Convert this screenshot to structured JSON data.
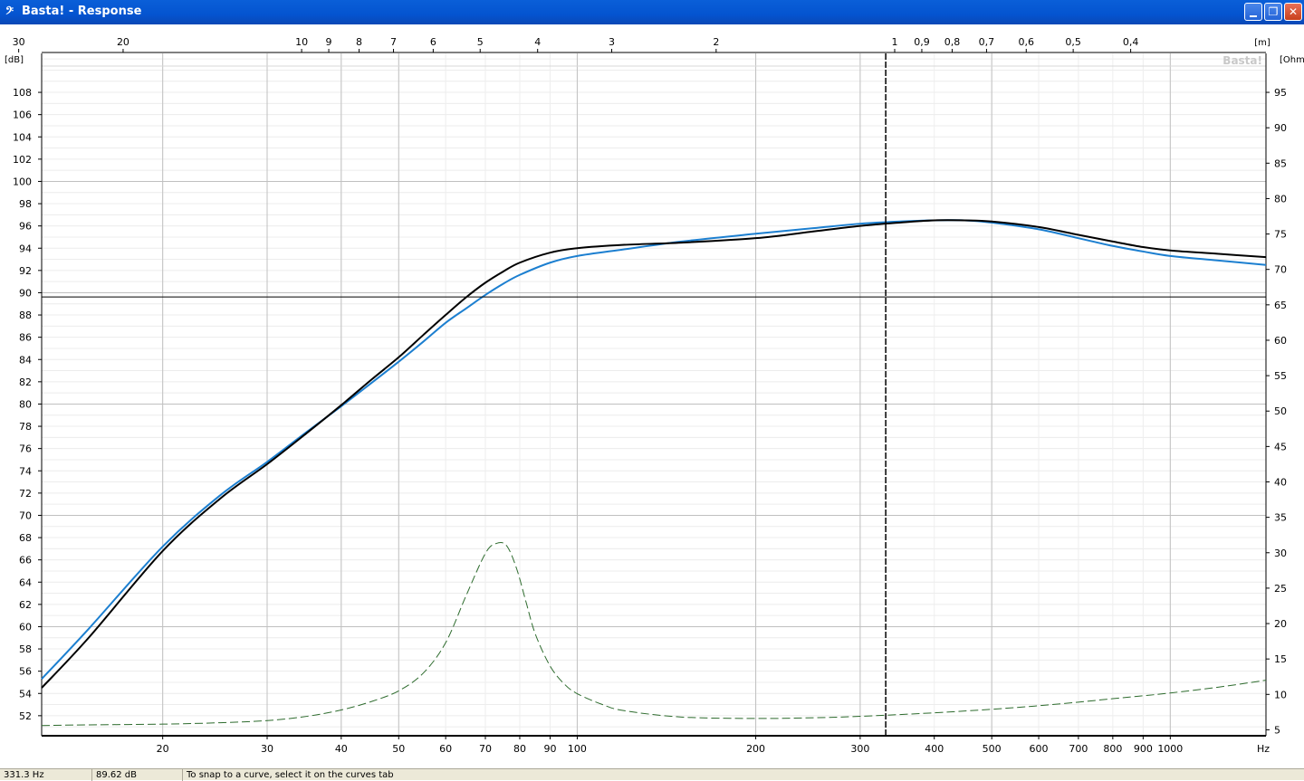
{
  "window": {
    "app_icon": "bass-clef-icon",
    "title": "Basta! - Response",
    "buttons": [
      "minimize",
      "restore",
      "close"
    ]
  },
  "statusbar": {
    "frequency": "331.3 Hz",
    "level": "89.62 dB",
    "hint": "To snap to a curve, select it on the curves tab"
  },
  "colors": {
    "response_blue": "#1c7fd0",
    "response_black": "#000000",
    "impedance_green": "#2d6b2d",
    "grid": "#c0c0c0"
  },
  "chart_data": {
    "type": "line",
    "watermark": "Basta!",
    "x_scale": "log",
    "xlim": [
      12.5,
      1450
    ],
    "x_ticks": [
      20,
      30,
      40,
      50,
      60,
      70,
      80,
      90,
      100,
      200,
      300,
      400,
      500,
      600,
      700,
      800,
      900,
      1000
    ],
    "x_unit": "Hz",
    "top_axis": {
      "unit": "[m]",
      "ticks": [
        30,
        20,
        10,
        9,
        8,
        7,
        6,
        5,
        4,
        3,
        2,
        1,
        0.9,
        0.8,
        0.7,
        0.6,
        0.5,
        0.4
      ],
      "tick_labels": [
        "30",
        "20",
        "10",
        "9",
        "8",
        "7",
        "6",
        "5",
        "4",
        "3",
        "2",
        "1",
        "0,9",
        "0,8",
        "0,7",
        "0,6",
        "0,5",
        "0,4"
      ]
    },
    "y_left": {
      "unit": "[dB]",
      "ylim": [
        50.2,
        111.5
      ],
      "ticks": [
        52,
        54,
        56,
        58,
        60,
        62,
        64,
        66,
        68,
        70,
        72,
        74,
        76,
        78,
        80,
        82,
        84,
        86,
        88,
        90,
        92,
        94,
        96,
        98,
        100,
        102,
        104,
        106,
        108
      ]
    },
    "y_right": {
      "unit": "[Ohm]",
      "ylim": [
        4.16,
        100.5
      ],
      "ticks": [
        5,
        10,
        15,
        20,
        25,
        30,
        35,
        40,
        45,
        50,
        55,
        60,
        65,
        70,
        75,
        80,
        85,
        90,
        95
      ]
    },
    "cursor": {
      "x": 331.3,
      "y": 89.62
    },
    "series": [
      {
        "color": "#1c7fd0",
        "style": "solid",
        "axis": "left",
        "x": [
          12.5,
          15,
          20,
          25,
          30,
          35,
          40,
          45,
          50,
          55,
          60,
          65,
          70,
          75,
          80,
          90,
          100,
          120,
          150,
          200,
          250,
          300,
          350,
          400,
          450,
          500,
          600,
          700,
          800,
          900,
          1000,
          1200,
          1450
        ],
        "y": [
          55.3,
          59.8,
          67.2,
          71.8,
          74.8,
          77.5,
          79.8,
          81.9,
          83.8,
          85.6,
          87.3,
          88.6,
          89.8,
          90.8,
          91.6,
          92.7,
          93.3,
          93.9,
          94.6,
          95.3,
          95.8,
          96.2,
          96.4,
          96.5,
          96.5,
          96.3,
          95.7,
          94.9,
          94.2,
          93.7,
          93.3,
          92.9,
          92.5
        ]
      },
      {
        "color": "#000000",
        "style": "solid",
        "axis": "left",
        "x": [
          12.5,
          15,
          20,
          25,
          30,
          35,
          40,
          45,
          50,
          55,
          60,
          65,
          70,
          75,
          80,
          90,
          100,
          120,
          150,
          200,
          250,
          300,
          350,
          400,
          450,
          500,
          600,
          700,
          800,
          900,
          1000,
          1200,
          1450
        ],
        "y": [
          54.5,
          59.0,
          66.8,
          71.5,
          74.6,
          77.4,
          79.9,
          82.2,
          84.2,
          86.2,
          88.0,
          89.6,
          90.9,
          91.9,
          92.7,
          93.6,
          94.0,
          94.3,
          94.5,
          94.9,
          95.5,
          96.0,
          96.3,
          96.5,
          96.5,
          96.4,
          95.9,
          95.2,
          94.6,
          94.1,
          93.8,
          93.5,
          93.2
        ]
      },
      {
        "color": "#2d6b2d",
        "style": "dashed",
        "axis": "right",
        "x": [
          12.5,
          15,
          20,
          25,
          30,
          35,
          40,
          45,
          50,
          55,
          60,
          65,
          70,
          73,
          76,
          79,
          82,
          85,
          90,
          95,
          100,
          110,
          120,
          150,
          200,
          250,
          300,
          400,
          500,
          600,
          700,
          800,
          900,
          1000,
          1200,
          1450
        ],
        "y": [
          5.6,
          5.7,
          5.8,
          6.0,
          6.3,
          6.9,
          7.8,
          9.0,
          10.5,
          13.0,
          17.3,
          24.0,
          29.9,
          31.3,
          31.0,
          27.8,
          23.0,
          18.5,
          14.0,
          11.5,
          10.1,
          8.6,
          7.7,
          6.8,
          6.6,
          6.7,
          6.9,
          7.4,
          7.9,
          8.4,
          8.9,
          9.4,
          9.8,
          10.2,
          11.0,
          12.0
        ]
      }
    ]
  }
}
